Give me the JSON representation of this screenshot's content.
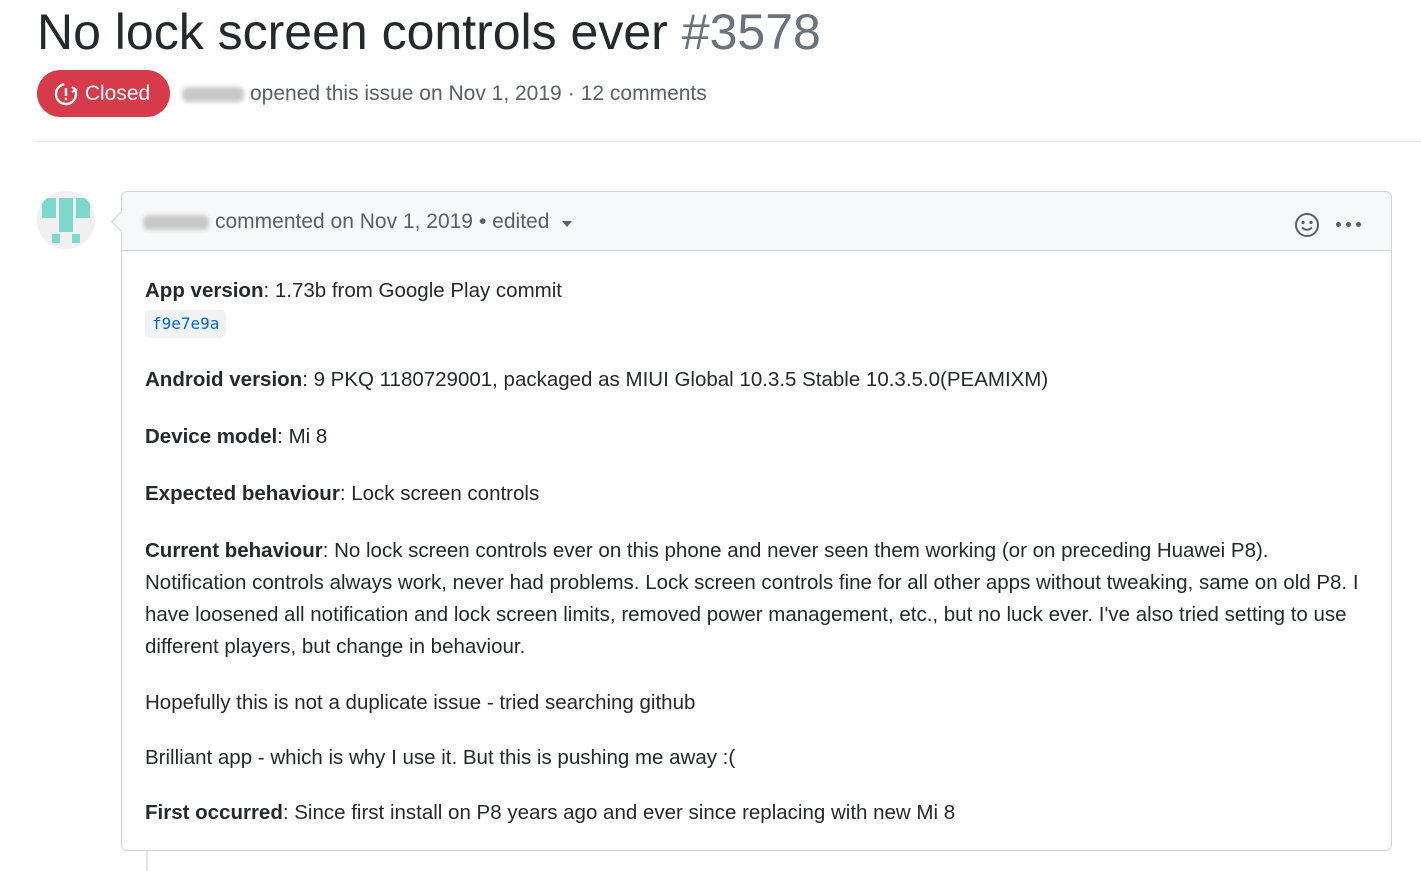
{
  "issue": {
    "title": "No lock screen controls ever",
    "number": "#3578",
    "state": "Closed",
    "state_color": "#d73a49",
    "opened_text": "opened this issue on Nov 1, 2019",
    "separator": "·",
    "comments_count": "12 comments"
  },
  "comment": {
    "meta": "commented on Nov 1, 2019",
    "edited": "• edited",
    "add_reaction_icon": "smiley-icon",
    "more_icon": "kebab-horizontal-icon",
    "fields": {
      "app_version_label": "App version",
      "app_version_value": ": 1.73b from Google Play commit",
      "commit_sha": "f9e7e9a",
      "android_version_label": "Android version",
      "android_version_value": ": 9 PKQ 1180729001, packaged as MIUI Global 10.3.5 Stable 10.3.5.0(PEAMIXM)",
      "device_model_label": "Device model",
      "device_model_value": ": Mi 8",
      "expected_label": "Expected behaviour",
      "expected_value": ": Lock screen controls",
      "current_label": "Current behaviour",
      "current_value": ": No lock screen controls ever on this phone and never seen them working (or on preceding Huawei P8). Notification controls always work, never had problems. Lock screen controls fine for all other apps without tweaking, same on old P8. I have loosened all notification and lock screen limits, removed power management, etc., but no luck ever. I've also tried setting to use different players, but change in behaviour.",
      "first_occurred_label": "First occurred",
      "first_occurred_value": ": Since first install on P8 years ago and ever since replacing with new Mi 8"
    },
    "paragraph_duplicate": "Hopefully this is not a duplicate issue - tried searching github",
    "paragraph_brilliant": "Brilliant app - which is why I use it. But this is pushing me away :("
  },
  "colors": {
    "link": "#0366d6",
    "muted": "#586069",
    "avatar_teal": "#7fd6cc"
  }
}
